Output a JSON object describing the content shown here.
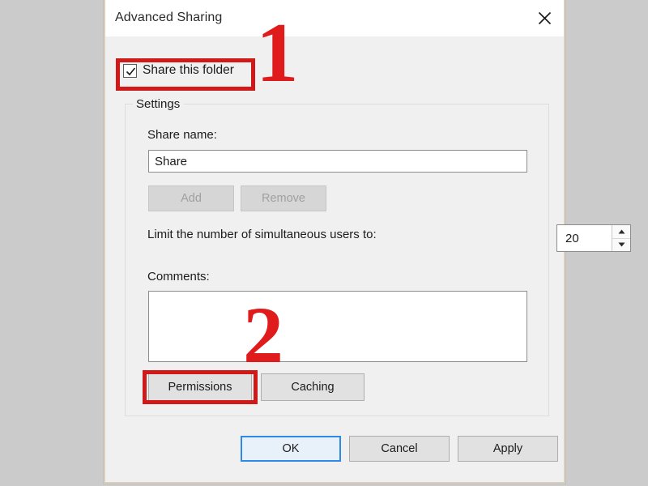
{
  "window": {
    "title": "Advanced Sharing",
    "close_icon": "close-icon"
  },
  "share_folder": {
    "label": "Share this folder",
    "checked": true,
    "check_icon": "checkmark-icon"
  },
  "settings": {
    "legend": "Settings",
    "share_name": {
      "label": "Share name:",
      "value": "Share"
    },
    "add_button": {
      "label": "Add",
      "disabled": true
    },
    "remove_button": {
      "label": "Remove",
      "disabled": true
    },
    "limit_users": {
      "label": "Limit the number of simultaneous users to:",
      "value": "20",
      "up_icon": "triangle-up-icon",
      "down_icon": "triangle-down-icon"
    },
    "comments": {
      "label": "Comments:",
      "value": ""
    },
    "permissions_button": "Permissions",
    "caching_button": "Caching"
  },
  "footer": {
    "ok": "OK",
    "cancel": "Cancel",
    "apply": "Apply"
  },
  "annotations": {
    "step_one": "1",
    "step_two": "2",
    "highlight_color": "#d01919",
    "number_color": "#e01b1b"
  }
}
